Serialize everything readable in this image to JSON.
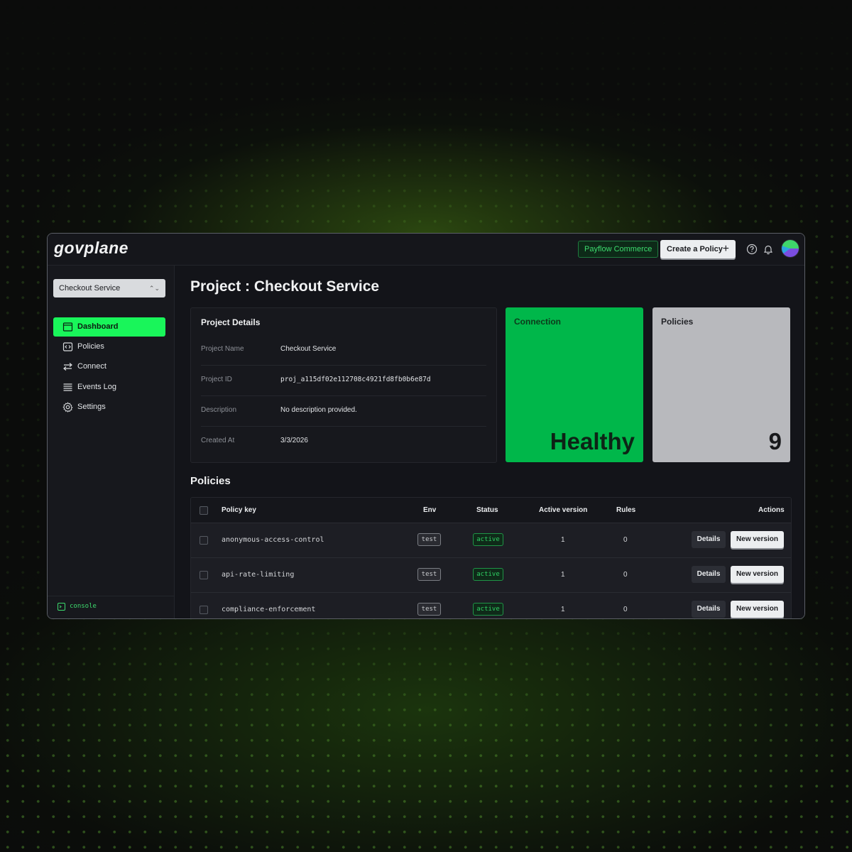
{
  "app": {
    "logo": "govplane"
  },
  "header": {
    "org_badge": "Payflow Commerce",
    "create_button": "Create a Policy",
    "create_icon": "+",
    "help_icon": "help-circle-icon",
    "bell_icon": "bell-icon"
  },
  "sidebar": {
    "project_select": "Checkout Service",
    "items": [
      {
        "label": "Dashboard",
        "icon": "dashboard-icon",
        "active": true
      },
      {
        "label": "Policies",
        "icon": "code-file-icon",
        "active": false
      },
      {
        "label": "Connect",
        "icon": "arrows-exchange-icon",
        "active": false
      },
      {
        "label": "Events Log",
        "icon": "list-icon",
        "active": false
      },
      {
        "label": "Settings",
        "icon": "gear-icon",
        "active": false
      }
    ],
    "console_label": "console"
  },
  "page": {
    "title": "Project : Checkout Service",
    "details": {
      "title": "Project Details",
      "rows": [
        {
          "label": "Project Name",
          "value": "Checkout Service"
        },
        {
          "label": "Project ID",
          "value": "proj_a115df02e112708c4921fd8fb0b6e87d"
        },
        {
          "label": "Description",
          "value": "No description provided."
        },
        {
          "label": "Created At",
          "value": "3/3/2026"
        }
      ]
    },
    "connection": {
      "label": "Connection",
      "value": "Healthy"
    },
    "policies_card": {
      "label": "Policies",
      "value": "9"
    },
    "policies_heading": "Policies",
    "table": {
      "columns": [
        "Policy key",
        "Env",
        "Status",
        "Active version",
        "Rules",
        "Actions"
      ],
      "rows": [
        {
          "key": "anonymous-access-control",
          "env": "test",
          "status": "active",
          "active_version": "1",
          "rules": "0",
          "details": "Details",
          "new_version": "New version"
        },
        {
          "key": "api-rate-limiting",
          "env": "test",
          "status": "active",
          "active_version": "1",
          "rules": "0",
          "details": "Details",
          "new_version": "New version"
        },
        {
          "key": "compliance-enforcement",
          "env": "test",
          "status": "active",
          "active_version": "1",
          "rules": "0",
          "details": "Details",
          "new_version": "New version"
        }
      ]
    }
  },
  "colors": {
    "accent": "#19f55a",
    "connection_card": "#00b74a",
    "policies_card": "#b8b9bd",
    "background": "#131419"
  }
}
